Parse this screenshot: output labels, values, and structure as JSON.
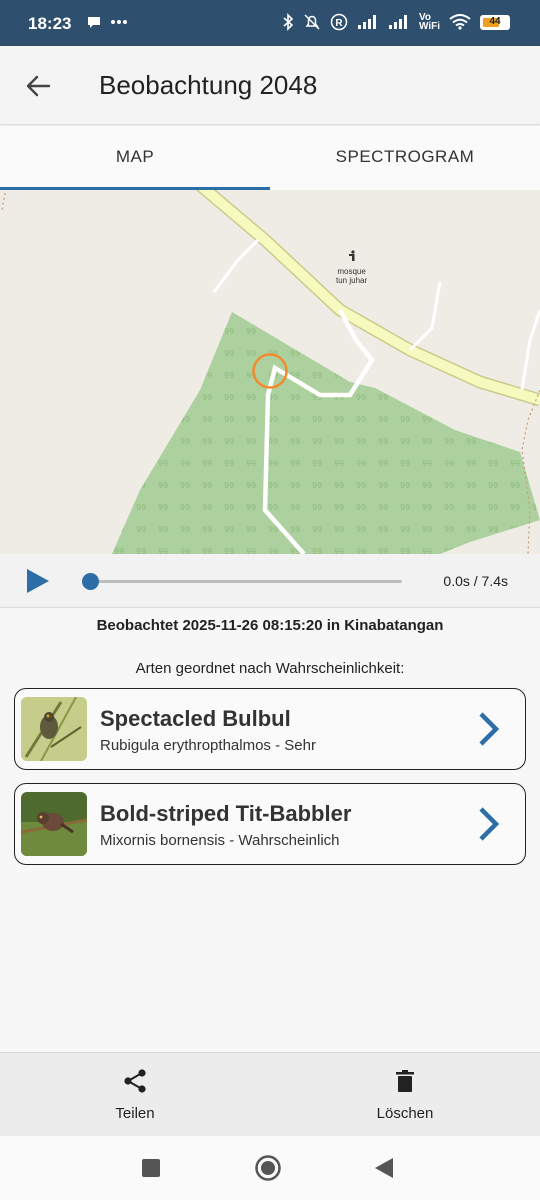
{
  "status_bar": {
    "time": "18:23",
    "left_icons": [
      "chat-bubble-icon",
      "more-dots-icon"
    ],
    "right_icons": [
      "bluetooth-icon",
      "bell-muted-icon",
      "registered-icon",
      "signal-icon",
      "signal-icon",
      "vowifi-icon",
      "wifi-icon",
      "battery-icon"
    ],
    "vowifi_label": "Vo\nWiFi",
    "battery_level": "44"
  },
  "app_bar": {
    "back_icon": "arrow-back-icon",
    "title": "Beobachtung 2048"
  },
  "tabs": [
    {
      "label": "MAP",
      "active": true
    },
    {
      "label": "SPECTROGRAM",
      "active": false
    }
  ],
  "map": {
    "poi_icon": "mosque-icon",
    "poi_label_line1": "mosque",
    "poi_label_line2": "tun juhar",
    "colors": {
      "background": "#efece6",
      "forest": "#add19e",
      "road_major": "#f7fabf",
      "road_major_casing": "#c8cc8a",
      "path": "#ffffff",
      "marker": "#f28a30"
    }
  },
  "player": {
    "play_icon": "play-icon",
    "progress": 0,
    "time_text": "0.0s / 7.4s"
  },
  "observation": {
    "observed_text": "Beobachtet 2025-11-26 08:15:20 in Kinabatangan",
    "sorted_label": "Arten geordnet nach Wahrscheinlichkeit:"
  },
  "species": [
    {
      "common_name": "Spectacled Bulbul",
      "subtitle": "Rubigula erythropthalmos - Sehr",
      "icon": "chevron-right-icon"
    },
    {
      "common_name": "Bold-striped Tit-Babbler",
      "subtitle": "Mixornis bornensis - Wahrscheinlich",
      "icon": "chevron-right-icon"
    }
  ],
  "bottom_bar": {
    "share_label": "Teilen",
    "share_icon": "share-icon",
    "delete_label": "Löschen",
    "delete_icon": "trash-icon"
  },
  "nav_bar": {
    "recents_icon": "square-icon",
    "home_icon": "home-circle-icon",
    "back_icon": "triangle-back-icon"
  },
  "accent_color": "#2d6ea8",
  "status_bar_color": "#2f4f6e"
}
